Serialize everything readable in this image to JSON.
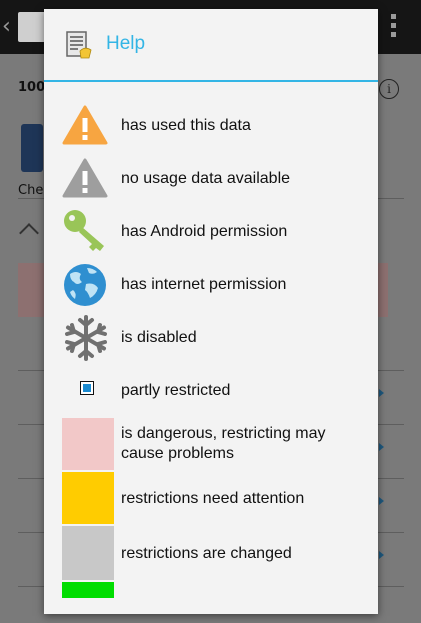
{
  "dialog": {
    "title": "Help",
    "items": [
      {
        "icon": "warning-orange-icon",
        "label": "has used this data"
      },
      {
        "icon": "warning-grey-icon",
        "label": "no usage data available"
      },
      {
        "icon": "key-icon",
        "label": "has Android permission"
      },
      {
        "icon": "globe-icon",
        "label": "has internet permission"
      },
      {
        "icon": "snowflake-icon",
        "label": "is disabled"
      },
      {
        "icon": "partial-square-icon",
        "label": "partly restricted"
      },
      {
        "icon": "pink-swatch",
        "label": "is dangerous, restricting may cause problems",
        "color": "#f2c8c8"
      },
      {
        "icon": "yellow-swatch",
        "label": "restrictions need attention",
        "color": "#ffcc00"
      },
      {
        "icon": "grey-swatch",
        "label": "restrictions are changed",
        "color": "#c8c8c8"
      },
      {
        "icon": "green-swatch",
        "label": "",
        "color": "#00dd00"
      }
    ]
  },
  "background": {
    "number_prefix": "100",
    "check_prefix": "Che"
  },
  "colors": {
    "accent": "#33b5e5",
    "warning": "#f7a541",
    "key": "#99c558",
    "globe": "#2f8fd0"
  }
}
